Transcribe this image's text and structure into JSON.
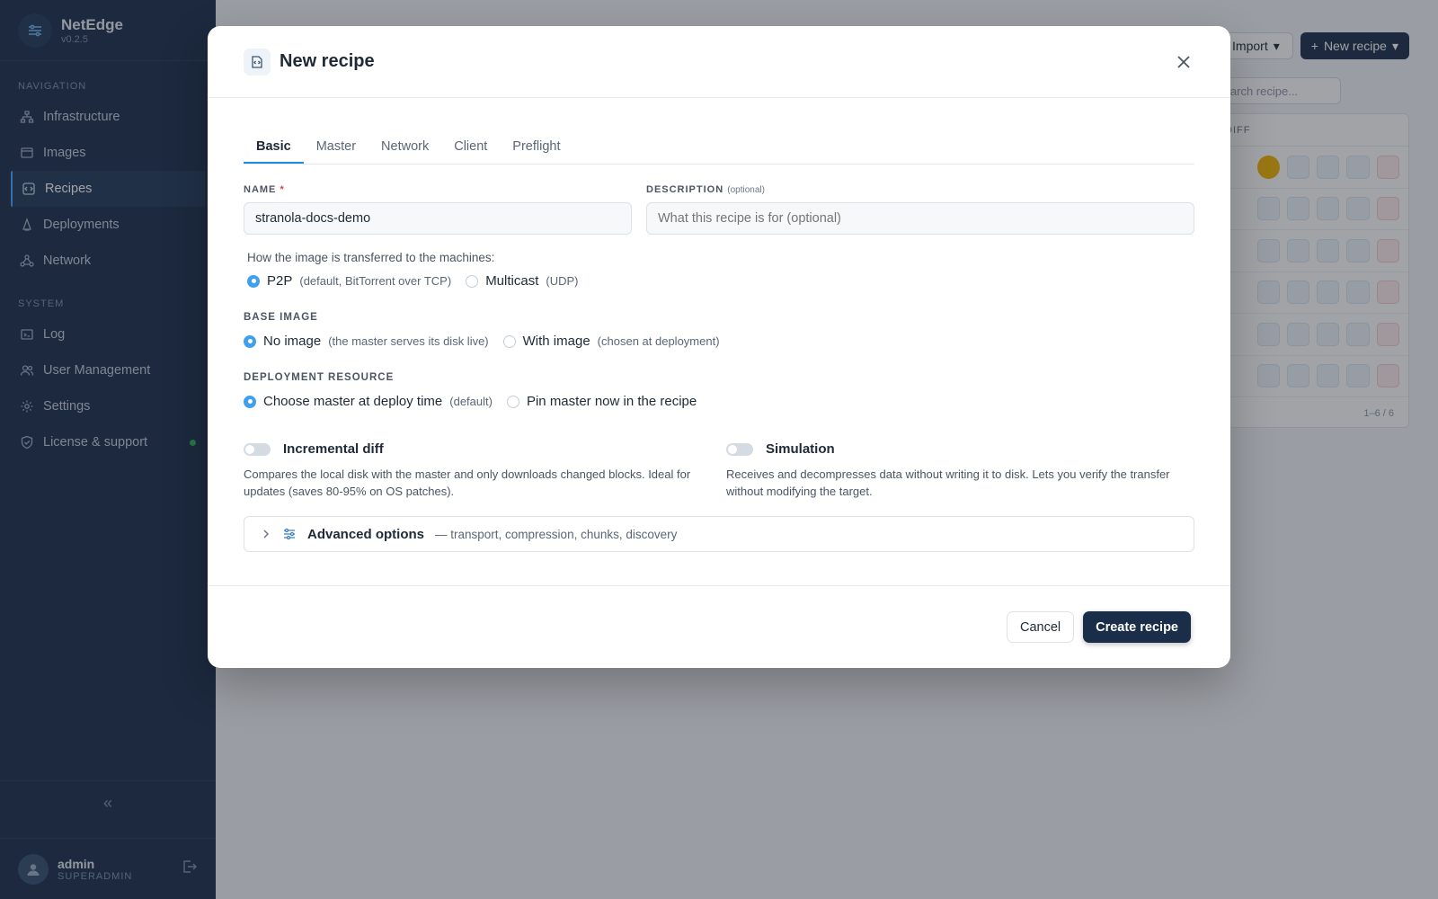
{
  "app": {
    "name": "NetEdge",
    "version": "v0.2.5"
  },
  "sidebar": {
    "sections": [
      {
        "title": "NAVIGATION",
        "items": [
          {
            "label": "Infrastructure",
            "icon": "infrastructure-icon"
          },
          {
            "label": "Images",
            "icon": "images-icon"
          },
          {
            "label": "Recipes",
            "icon": "recipes-icon",
            "active": true
          },
          {
            "label": "Deployments",
            "icon": "deployments-icon"
          },
          {
            "label": "Network",
            "icon": "network-icon"
          }
        ]
      },
      {
        "title": "SYSTEM",
        "items": [
          {
            "label": "Log",
            "icon": "log-icon"
          },
          {
            "label": "User Management",
            "icon": "users-icon"
          },
          {
            "label": "Settings",
            "icon": "gear-icon"
          },
          {
            "label": "License & support",
            "icon": "shield-icon",
            "status": "online"
          }
        ]
      }
    ],
    "collapse_glyph": "«",
    "user": {
      "name": "admin",
      "role": "SUPERADMIN"
    }
  },
  "background_page": {
    "import_label": "Import",
    "new_recipe_label": "New recipe",
    "search_placeholder": "Search recipe...",
    "column_header": "DIFF",
    "pager": "1–6 / 6",
    "rows": 6
  },
  "modal": {
    "title": "New recipe",
    "tabs": [
      "Basic",
      "Master",
      "Network",
      "Client",
      "Preflight"
    ],
    "active_tab": "Basic",
    "name_label": "NAME",
    "name_required": "*",
    "name_value": "stranola-docs-demo",
    "description_label": "DESCRIPTION",
    "description_optional": "(optional)",
    "description_placeholder": "What this recipe is for (optional)",
    "transfer_question": "How the image is transferred to the machines:",
    "transfer_options": [
      {
        "label": "P2P",
        "hint": "(default, BitTorrent over TCP)",
        "selected": true
      },
      {
        "label": "Multicast",
        "hint": "(UDP)",
        "selected": false
      }
    ],
    "base_image_label": "BASE IMAGE",
    "base_image_options": [
      {
        "label": "No image",
        "hint": "(the master serves its disk live)",
        "selected": true
      },
      {
        "label": "With image",
        "hint": "(chosen at deployment)",
        "selected": false
      }
    ],
    "deployment_resource_label": "DEPLOYMENT RESOURCE",
    "deployment_resource_options": [
      {
        "label": "Choose master at deploy time",
        "hint": "(default)",
        "selected": true
      },
      {
        "label": "Pin master now in the recipe",
        "hint": "",
        "selected": false
      }
    ],
    "toggles": [
      {
        "label": "Incremental diff",
        "on": false,
        "description": "Compares the local disk with the master and only downloads changed blocks. Ideal for updates (saves 80-95% on OS patches)."
      },
      {
        "label": "Simulation",
        "on": false,
        "description": "Receives and decompresses data without writing it to disk. Lets you verify the transfer without modifying the target."
      }
    ],
    "advanced": {
      "label": "Advanced options",
      "hint": "— transport, compression, chunks, discovery"
    },
    "cancel_label": "Cancel",
    "create_label": "Create recipe"
  },
  "colors": {
    "sidebar_bg": "#1a2e4a",
    "accent": "#3fa0f0",
    "primary_button": "#1a2e4a"
  }
}
